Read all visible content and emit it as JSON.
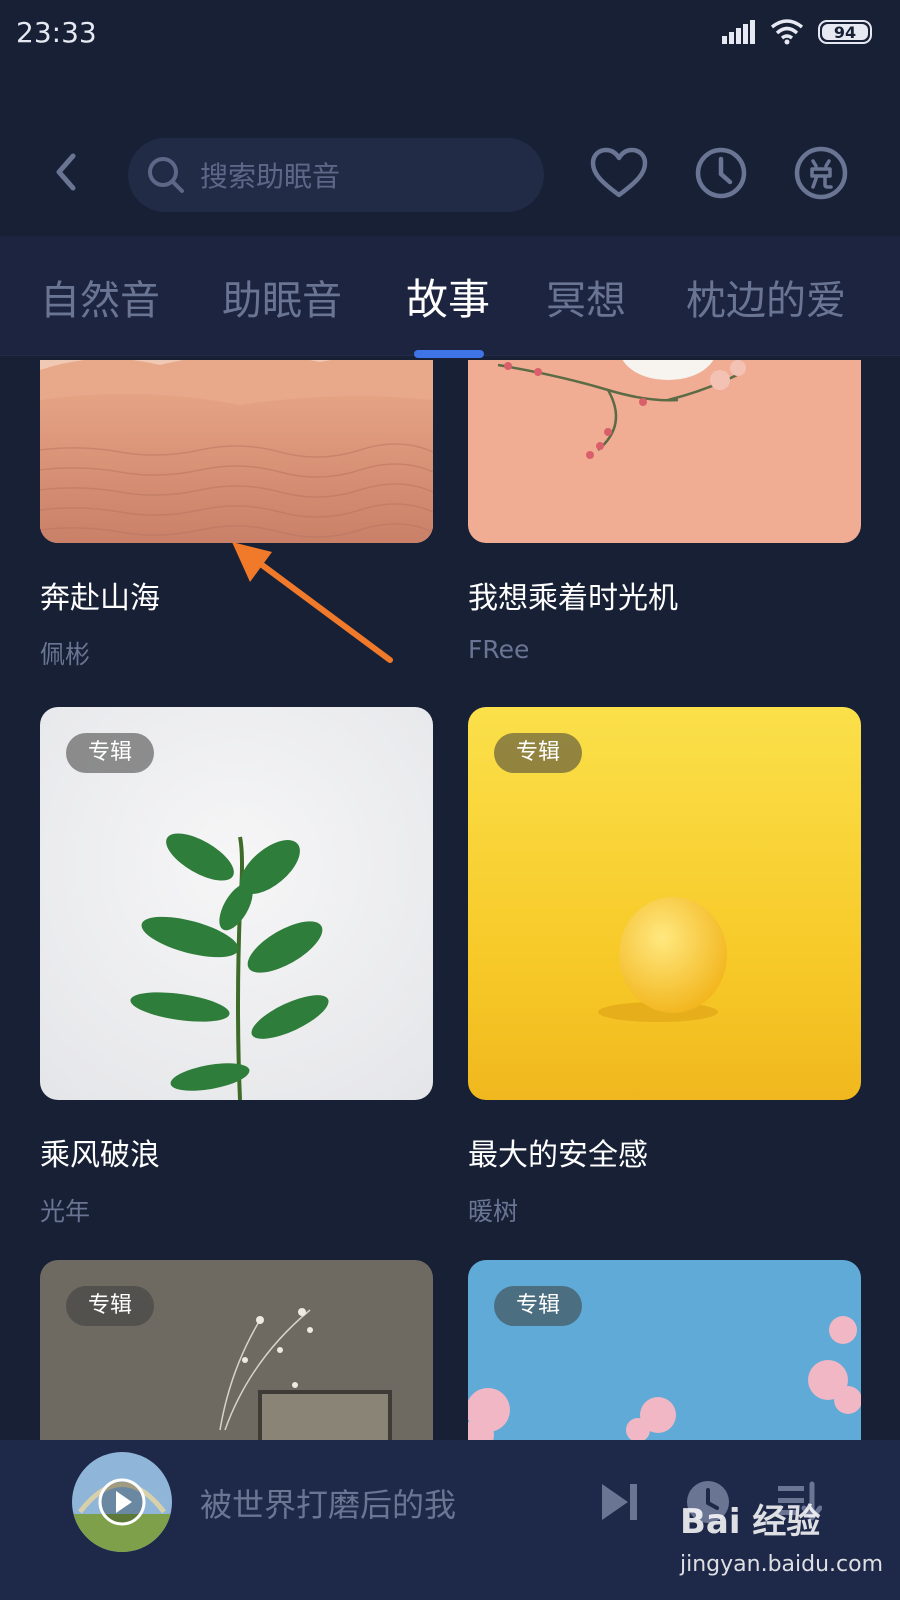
{
  "status_bar": {
    "time": "23:33",
    "battery": "94"
  },
  "search": {
    "placeholder": "搜索助眠音"
  },
  "tabs": [
    {
      "label": "自然音"
    },
    {
      "label": "助眠音"
    },
    {
      "label": "故事"
    },
    {
      "label": "冥想"
    },
    {
      "label": "枕边的爱"
    }
  ],
  "active_tab": "故事",
  "cards": [
    {
      "title": "奔赴山海",
      "subtitle": "佩彬",
      "badge": ""
    },
    {
      "title": "我想乘着时光机",
      "subtitle": "FRee",
      "badge": ""
    },
    {
      "title": "乘风破浪",
      "subtitle": "光年",
      "badge": "专辑"
    },
    {
      "title": "最大的安全感",
      "subtitle": "暖树",
      "badge": "专辑"
    },
    {
      "title": "",
      "subtitle": "",
      "badge": "专辑"
    },
    {
      "title": "",
      "subtitle": "",
      "badge": "专辑"
    }
  ],
  "player": {
    "title": "被世界打磨后的我"
  },
  "watermark": {
    "brand": "Bai 经验",
    "url": "jingyan.baidu.com"
  },
  "colors": {
    "background": "#182036",
    "accent": "#3f74e6",
    "annotation_arrow": "#f07a2a"
  },
  "icons": [
    "back-icon",
    "search-icon",
    "heart-icon",
    "clock-icon",
    "redeem-icon",
    "play-icon",
    "skip-next-icon",
    "timer-icon",
    "playlist-icon"
  ]
}
